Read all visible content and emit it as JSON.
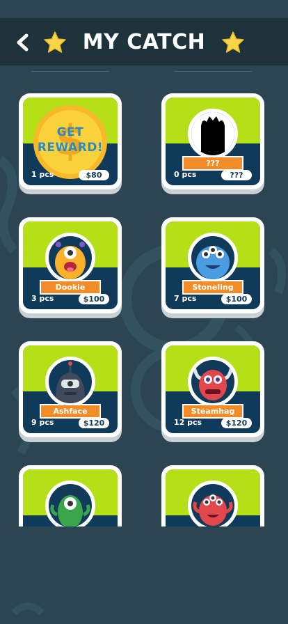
{
  "header": {
    "title": "MY CATCH"
  },
  "cards": [
    {
      "name": "",
      "pcs": "1 pcs",
      "price": "$80",
      "reward_line1": "GET",
      "reward_line2": "REWARD!"
    },
    {
      "name": "???",
      "pcs": "0 pcs",
      "price": "???"
    },
    {
      "name": "Dookie",
      "pcs": "3 pcs",
      "price": "$100"
    },
    {
      "name": "Stoneling",
      "pcs": "7 pcs",
      "price": "$100"
    },
    {
      "name": "Ashface",
      "pcs": "9 pcs",
      "price": "$120"
    },
    {
      "name": "Steamhag",
      "pcs": "12 pcs",
      "price": "$120"
    },
    {
      "name": "",
      "pcs": "",
      "price": ""
    },
    {
      "name": "",
      "pcs": "",
      "price": ""
    }
  ],
  "colors": {
    "background": "#2b4552",
    "header": "#1e323c",
    "card_green": "#b5e017",
    "card_navy": "#0f3a5a",
    "name_bar": "#f28c28",
    "star": "#f7d64a"
  },
  "icons": [
    "back-arrow-icon",
    "star-icon",
    "coin-icon"
  ]
}
